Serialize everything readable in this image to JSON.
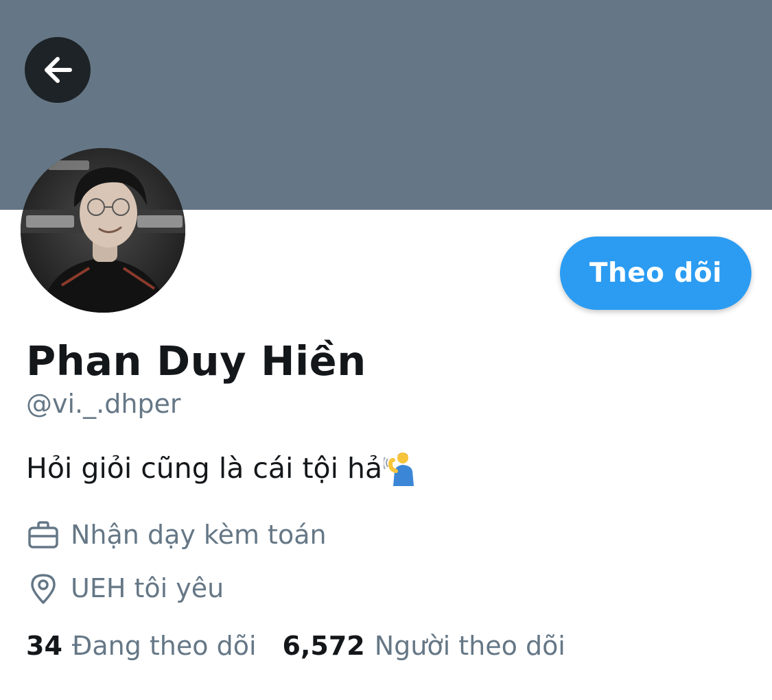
{
  "header": {
    "banner_color": "#657786",
    "back_icon": "arrow-left-icon"
  },
  "profile": {
    "avatar_icon": "profile-photo",
    "follow_label": "Theo dõi",
    "display_name": "Phan Duy Hiền",
    "handle": "@vi._.dhper",
    "bio": "Hỏi giỏi cũng là cái tội hả",
    "bio_emoji": "person-tipping-hand-emoji",
    "work": {
      "icon": "briefcase-icon",
      "text": "Nhận dạy kèm toán"
    },
    "location": {
      "icon": "location-pin-icon",
      "text": "UEH tôi yêu"
    }
  },
  "stats": {
    "following_count": "34",
    "following_label": "Đang theo dõi",
    "followers_count": "6,572",
    "followers_label": "Người theo dõi"
  },
  "colors": {
    "accent": "#2b9cf2",
    "text_primary": "#14171a",
    "text_secondary": "#657786"
  }
}
